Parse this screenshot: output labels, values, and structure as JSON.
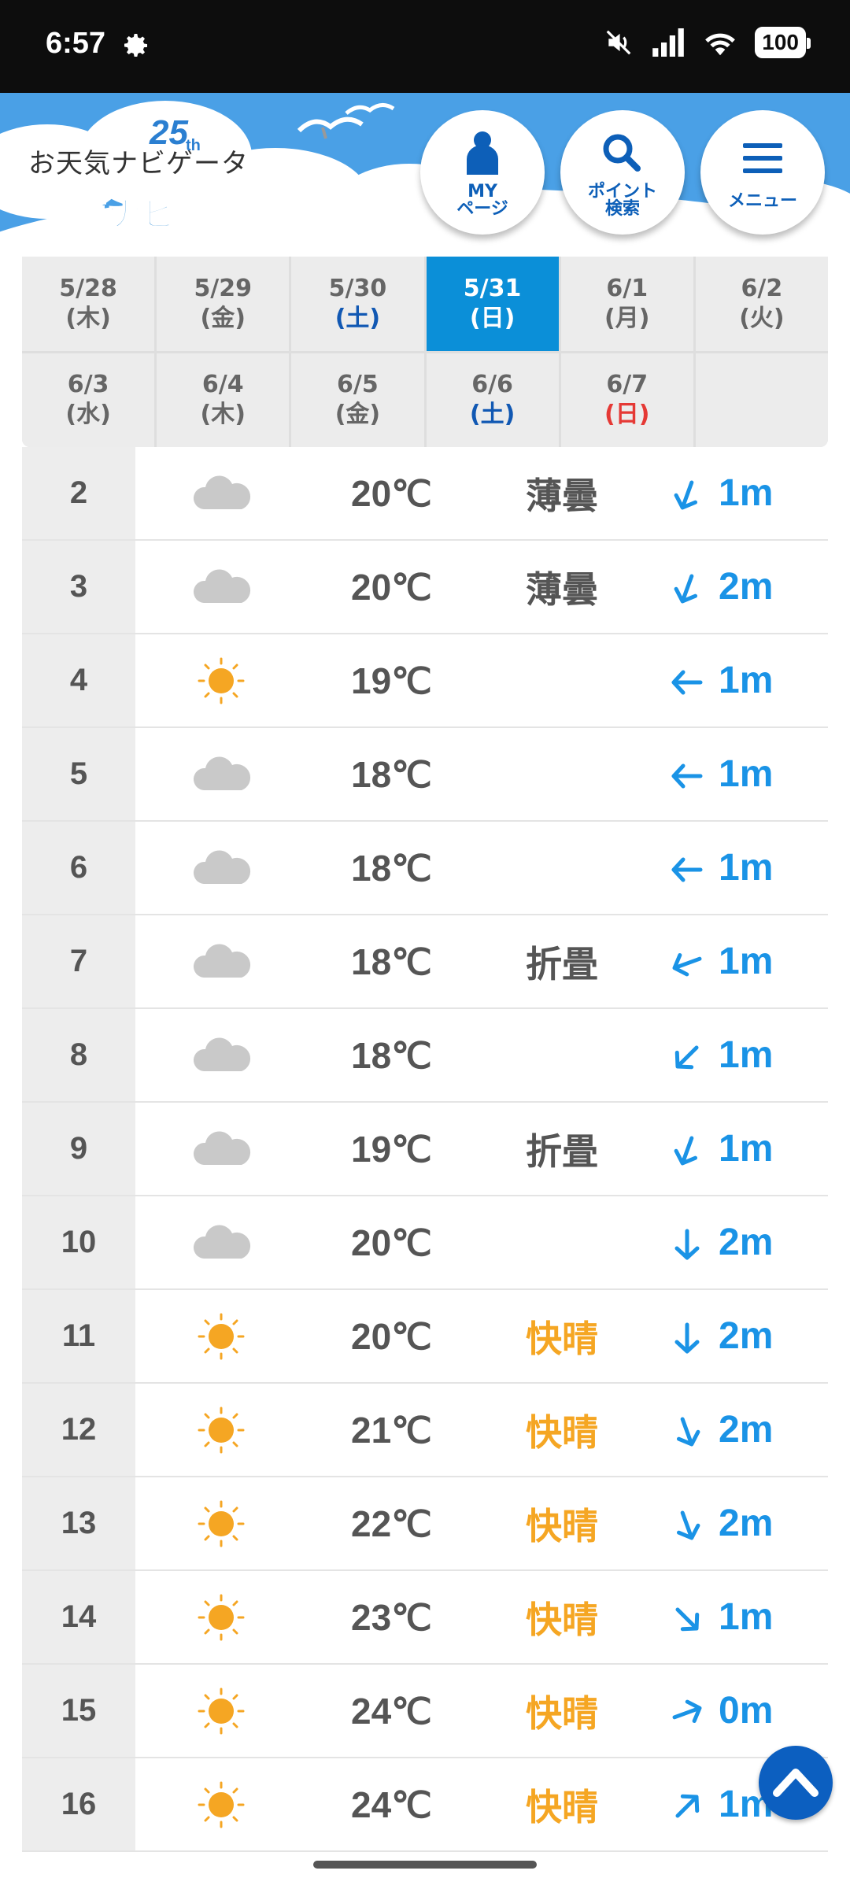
{
  "status_bar": {
    "time": "6:57",
    "battery": "100"
  },
  "header": {
    "logo_text": "お天気ナビゲータ",
    "logo_anniversary": "25",
    "logo_anniversary_suffix": "th",
    "sub_logo": "海ナビ",
    "buttons": [
      {
        "line1": "MY",
        "line2": "ページ",
        "icon": "person-icon"
      },
      {
        "line1": "ポイント",
        "line2": "検索",
        "icon": "search-icon"
      },
      {
        "line1": "メニュー",
        "line2": "",
        "icon": "menu-icon"
      }
    ]
  },
  "date_tabs": [
    {
      "date": "5/28",
      "dow": "(木)",
      "type": "weekday"
    },
    {
      "date": "5/29",
      "dow": "(金)",
      "type": "weekday"
    },
    {
      "date": "5/30",
      "dow": "(土)",
      "type": "sat"
    },
    {
      "date": "5/31",
      "dow": "(日)",
      "type": "sun",
      "active": true
    },
    {
      "date": "6/1",
      "dow": "(月)",
      "type": "weekday"
    },
    {
      "date": "6/2",
      "dow": "(火)",
      "type": "weekday"
    },
    {
      "date": "6/3",
      "dow": "(水)",
      "type": "weekday"
    },
    {
      "date": "6/4",
      "dow": "(木)",
      "type": "weekday"
    },
    {
      "date": "6/5",
      "dow": "(金)",
      "type": "weekday"
    },
    {
      "date": "6/6",
      "dow": "(土)",
      "type": "sat"
    },
    {
      "date": "6/7",
      "dow": "(日)",
      "type": "sun"
    },
    {
      "date": "",
      "dow": "",
      "type": "empty"
    }
  ],
  "colors": {
    "accent": "#0b8fd8",
    "wind": "#1a93e6",
    "kaisei": "#f5a623",
    "header": "#4aa0e6"
  },
  "rows": [
    {
      "hour": "2",
      "icon": "cloud",
      "temp": "20℃",
      "cond": "薄曇",
      "dir": 200,
      "wind": "1m"
    },
    {
      "hour": "3",
      "icon": "cloud",
      "temp": "20℃",
      "cond": "薄曇",
      "dir": 200,
      "wind": "2m"
    },
    {
      "hour": "4",
      "icon": "sun",
      "temp": "19℃",
      "cond": "",
      "dir": 270,
      "wind": "1m"
    },
    {
      "hour": "5",
      "icon": "cloud",
      "temp": "18℃",
      "cond": "",
      "dir": 270,
      "wind": "1m"
    },
    {
      "hour": "6",
      "icon": "cloud",
      "temp": "18℃",
      "cond": "",
      "dir": 270,
      "wind": "1m"
    },
    {
      "hour": "7",
      "icon": "cloud",
      "temp": "18℃",
      "cond": "折畳",
      "dir": 250,
      "wind": "1m"
    },
    {
      "hour": "8",
      "icon": "cloud",
      "temp": "18℃",
      "cond": "",
      "dir": 225,
      "wind": "1m"
    },
    {
      "hour": "9",
      "icon": "cloud",
      "temp": "19℃",
      "cond": "折畳",
      "dir": 200,
      "wind": "1m"
    },
    {
      "hour": "10",
      "icon": "cloud",
      "temp": "20℃",
      "cond": "",
      "dir": 180,
      "wind": "2m"
    },
    {
      "hour": "11",
      "icon": "sun",
      "temp": "20℃",
      "cond": "快晴",
      "dir": 180,
      "wind": "2m"
    },
    {
      "hour": "12",
      "icon": "sun",
      "temp": "21℃",
      "cond": "快晴",
      "dir": 160,
      "wind": "2m"
    },
    {
      "hour": "13",
      "icon": "sun",
      "temp": "22℃",
      "cond": "快晴",
      "dir": 160,
      "wind": "2m"
    },
    {
      "hour": "14",
      "icon": "sun",
      "temp": "23℃",
      "cond": "快晴",
      "dir": 135,
      "wind": "1m"
    },
    {
      "hour": "15",
      "icon": "sun",
      "temp": "24℃",
      "cond": "快晴",
      "dir": 70,
      "wind": "0m"
    },
    {
      "hour": "16",
      "icon": "sun",
      "temp": "24℃",
      "cond": "快晴",
      "dir": 45,
      "wind": "1m"
    }
  ]
}
